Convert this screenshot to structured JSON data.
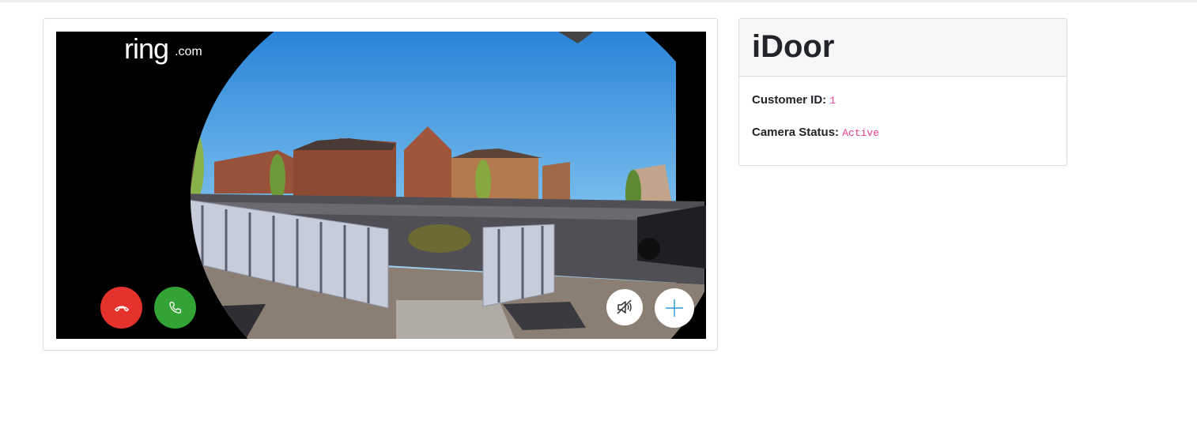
{
  "video": {
    "brand": "ring",
    "brand_suffix": ".com",
    "controls": {
      "hangup_icon": "hang-up-phone-icon",
      "answer_icon": "phone-icon",
      "mute_icon": "speaker-muted-icon",
      "add_icon": "plus-icon"
    }
  },
  "info": {
    "title": "iDoor",
    "customer_id_label": "Customer ID:",
    "customer_id_value": "1",
    "camera_status_label": "Camera Status:",
    "camera_status_value": "Active"
  },
  "colors": {
    "hangup": "#e5322d",
    "answer": "#34a336",
    "value_text": "#e83e8c"
  }
}
